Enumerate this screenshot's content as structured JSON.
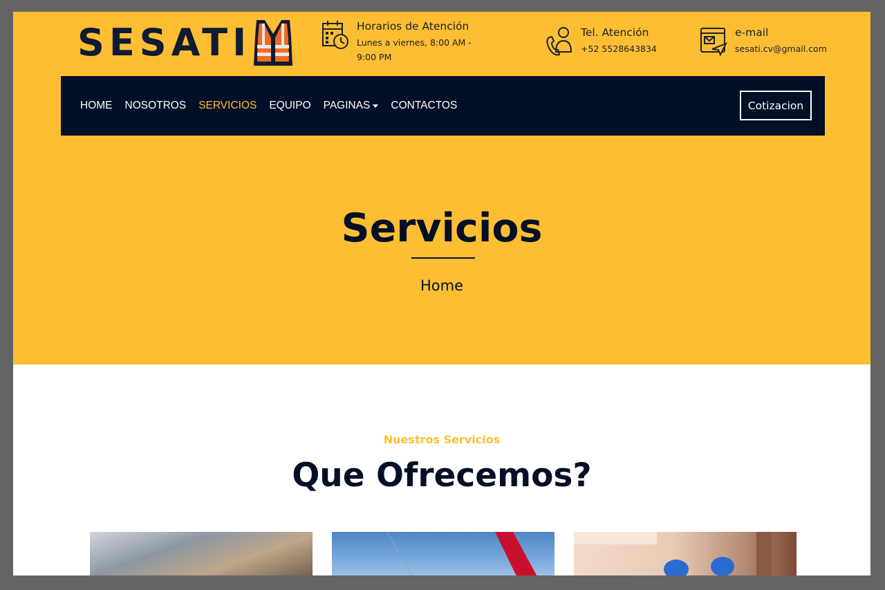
{
  "brand": {
    "name": "SESATI",
    "logo_icon": "safety-vest-icon"
  },
  "contact": {
    "hours_title": "Horarios de Atención",
    "hours_text": "Lunes a viernes, 8:00 AM - 9:00 PM",
    "phone_title": "Tel. Atención",
    "phone_number": "+52 5528643834",
    "email_title": "e-mail",
    "email_address": "sesati.cv@gmail.com"
  },
  "nav": {
    "items": [
      {
        "label": "HOME"
      },
      {
        "label": "NOSOTROS"
      },
      {
        "label": "SERVICIOS"
      },
      {
        "label": "EQUIPO"
      },
      {
        "label": "PAGINAS"
      },
      {
        "label": "CONTACTOS"
      }
    ],
    "active": "SERVICIOS",
    "quote_button": "Cotizacion"
  },
  "page_header": {
    "title": "Servicios",
    "breadcrumb": "Home"
  },
  "services": {
    "kicker": "Nuestros Servicios",
    "heading": "Que Ofrecemos?"
  },
  "colors": {
    "accent": "#fdbe33",
    "navy": "#030f27",
    "frame": "#646464"
  }
}
